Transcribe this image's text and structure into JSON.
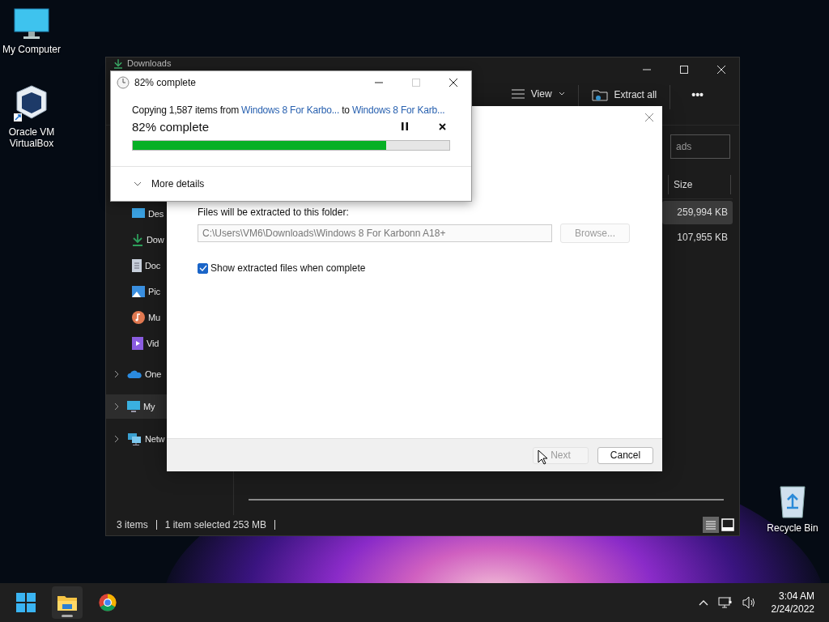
{
  "desktop_icons": [
    {
      "kind": "computer",
      "label": "My Computer"
    },
    {
      "kind": "virtualbox",
      "label": "Oracle VM VirtualBox"
    },
    {
      "kind": "recycle",
      "label": "Recycle Bin"
    }
  ],
  "explorer": {
    "title": "Downloads",
    "toolbar": [
      {
        "kind": "view",
        "label": "View"
      },
      {
        "kind": "extract",
        "label": "Extract all"
      },
      {
        "kind": "more",
        "label": "•••"
      }
    ],
    "search": {
      "placeholder": "ads"
    },
    "columns": [
      "Size"
    ],
    "rows": [
      {
        "size": "259,994 KB",
        "selected": true
      },
      {
        "size": "107,955 KB",
        "selected": false
      }
    ],
    "sidebar": [
      {
        "kind": "desktop",
        "label": "Des",
        "expandable": false,
        "selected": false
      },
      {
        "kind": "downloads",
        "label": "Dow",
        "expandable": false,
        "selected": false
      },
      {
        "kind": "documents",
        "label": "Doc",
        "expandable": false,
        "selected": false
      },
      {
        "kind": "pictures",
        "label": "Pic",
        "expandable": false,
        "selected": false
      },
      {
        "kind": "music",
        "label": "Mu",
        "expandable": false,
        "selected": false
      },
      {
        "kind": "videos",
        "label": "Vid",
        "expandable": false,
        "selected": false
      },
      {
        "kind": "cloud",
        "label": "One",
        "expandable": true,
        "selected": false
      },
      {
        "kind": "computer",
        "label": "My",
        "expandable": true,
        "selected": true
      },
      {
        "kind": "network",
        "label": "Netw",
        "expandable": true,
        "selected": false
      }
    ],
    "status_bar": {
      "items": "3 items",
      "selection": "1 item selected  253 MB"
    }
  },
  "extract_dialog": {
    "folder_label": "Files will be extracted to this folder:",
    "folder_value": "C:\\Users\\VM6\\Downloads\\Windows 8 For Karbonn A18+",
    "browse": {
      "label": "Browse...",
      "disabled": true
    },
    "show_files": {
      "label": "Show extracted files when complete",
      "checked": true
    },
    "buttons": [
      {
        "label": "Next",
        "disabled": true
      },
      {
        "label": "Cancel",
        "disabled": false
      }
    ]
  },
  "progress_dialog": {
    "title": "82% complete",
    "message": {
      "prefix": "Copying 1,587 items from",
      "source": "Windows 8 For Karbo...",
      "middle": "to",
      "destination": "Windows 8 For Karb..."
    },
    "heading": "82% complete",
    "level": 0.8,
    "details": "More details"
  },
  "taskbar": {
    "apps": [
      {
        "kind": "start",
        "active": false
      },
      {
        "kind": "explorer",
        "active": true
      },
      {
        "kind": "browser",
        "active": false
      }
    ],
    "time": "3:04 AM",
    "date": "2/24/2022"
  }
}
